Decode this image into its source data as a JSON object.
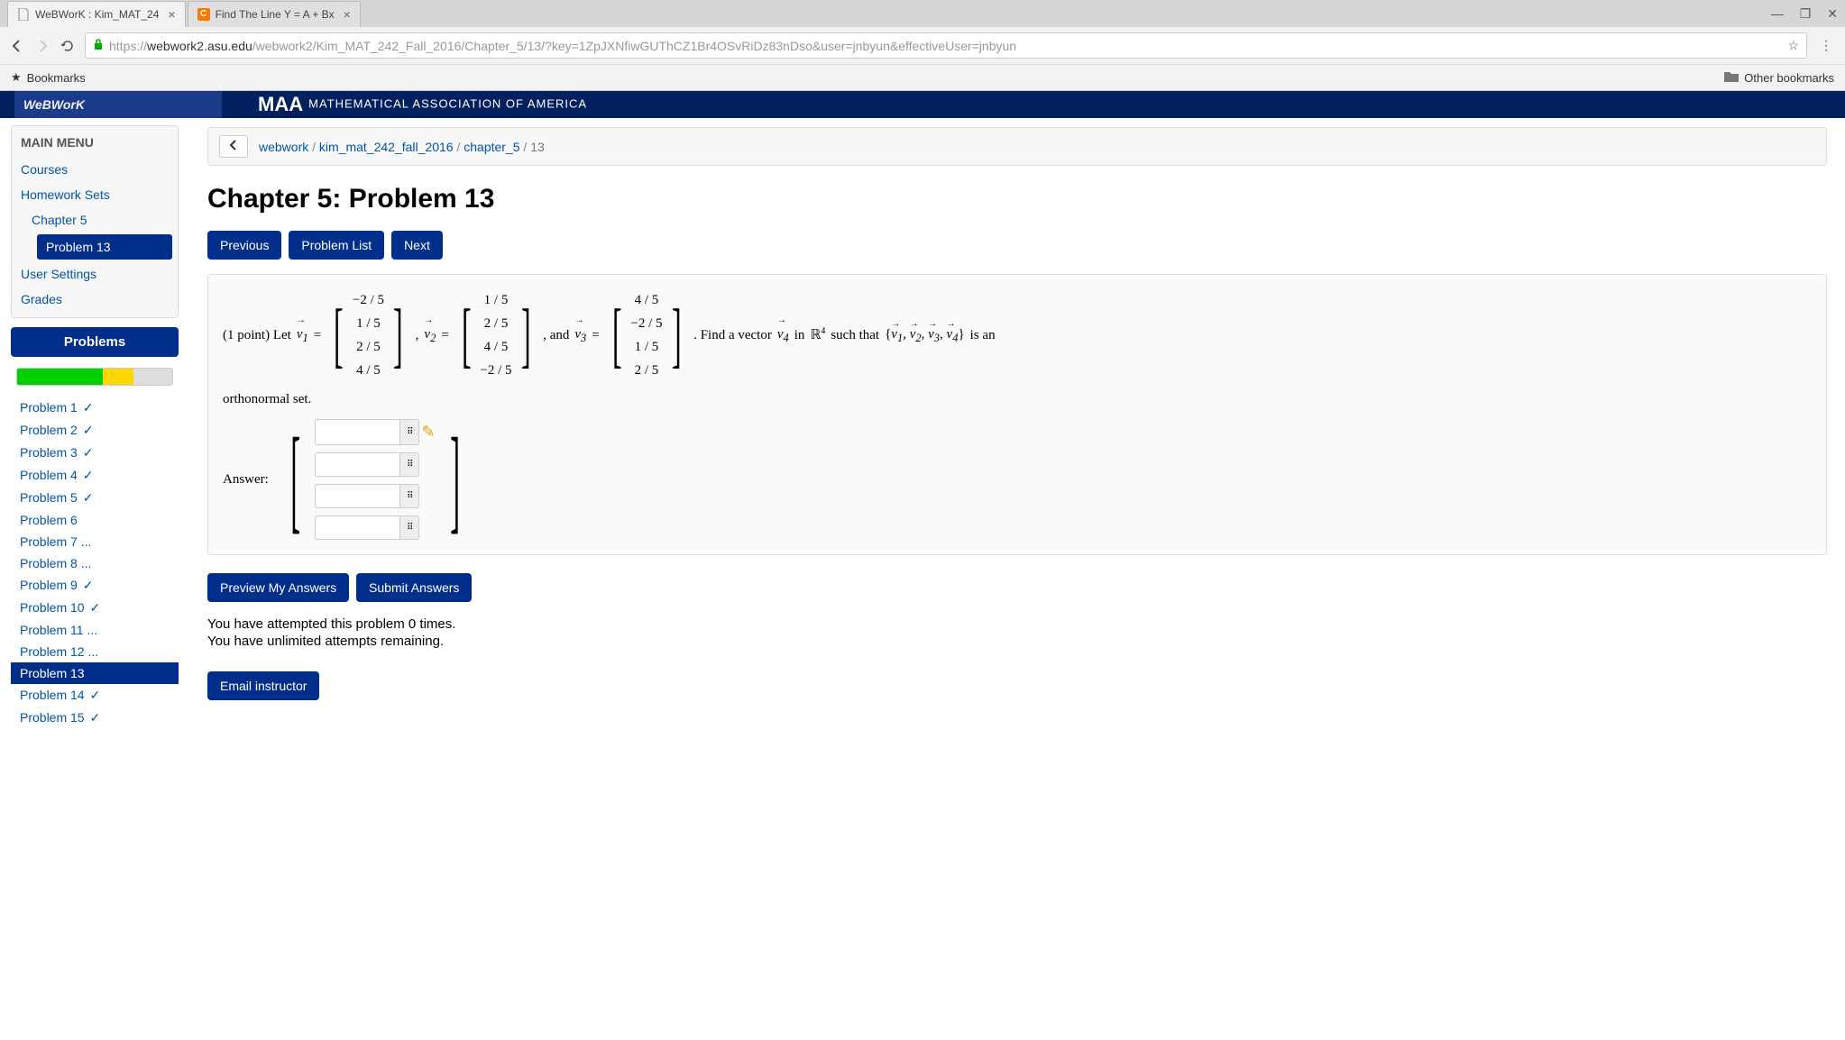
{
  "browser": {
    "tabs": [
      {
        "title": "WeBWorK : Kim_MAT_24",
        "active": true,
        "favicon": "page"
      },
      {
        "title": "Find The Line Y = A + Bx",
        "active": false,
        "favicon": "c"
      }
    ],
    "url_prefix": "https://",
    "url_host": "webwork2.asu.edu",
    "url_path": "/webwork2/Kim_MAT_242_Fall_2016/Chapter_5/13/?key=1ZpJXNfiwGUThCZ1Br4OSvRiDz83nDso&user=jnbyun&effectiveUser=jnbyun",
    "bookmarks_label": "Bookmarks",
    "other_bookmarks": "Other bookmarks"
  },
  "maa": {
    "webwork": "WeBWorK",
    "brand": "MAA",
    "subtitle": "MATHEMATICAL ASSOCIATION OF AMERICA"
  },
  "sidebar": {
    "main_menu": "MAIN MENU",
    "items": [
      "Courses",
      "Homework Sets",
      "Chapter 5",
      "Problem 13",
      "User Settings",
      "Grades"
    ],
    "problems_header": "Problems",
    "progress": {
      "green": 55,
      "yellow": 20,
      "gray": 25
    },
    "problem_list": [
      {
        "label": "Problem 1",
        "status": "check"
      },
      {
        "label": "Problem 2",
        "status": "check"
      },
      {
        "label": "Problem 3",
        "status": "check"
      },
      {
        "label": "Problem 4",
        "status": "check"
      },
      {
        "label": "Problem 5",
        "status": "check"
      },
      {
        "label": "Problem 6",
        "status": "none"
      },
      {
        "label": "Problem 7",
        "status": "dots"
      },
      {
        "label": "Problem 8",
        "status": "dots"
      },
      {
        "label": "Problem 9",
        "status": "check"
      },
      {
        "label": "Problem 10",
        "status": "check"
      },
      {
        "label": "Problem 11",
        "status": "dots"
      },
      {
        "label": "Problem 12",
        "status": "dots"
      },
      {
        "label": "Problem 13",
        "status": "none",
        "active": true
      },
      {
        "label": "Problem 14",
        "status": "check"
      },
      {
        "label": "Problem 15",
        "status": "check"
      }
    ]
  },
  "breadcrumb": {
    "items": [
      "webwork",
      "kim_mat_242_fall_2016",
      "chapter_5",
      "13"
    ]
  },
  "content": {
    "title": "Chapter 5: Problem 13",
    "nav": {
      "prev": "Previous",
      "list": "Problem List",
      "next": "Next"
    },
    "points_prefix": "(1 point) Let ",
    "v1": [
      "−2 / 5",
      "1 / 5",
      "2 / 5",
      "4 / 5"
    ],
    "v2": [
      "1 / 5",
      "2 / 5",
      "4 / 5",
      "−2 / 5"
    ],
    "v3": [
      "4 / 5",
      "−2 / 5",
      "1 / 5",
      "2 / 5"
    ],
    "connector_and": ", and ",
    "find_text": ". Find a vector ",
    "in_text": " in ",
    "r_label": "ℝ",
    "r_sup": "4",
    "such_that": " such that ",
    "set_text": " is an",
    "orthonormal": "orthonormal set.",
    "answer_label": "Answer:",
    "preview": "Preview My Answers",
    "submit": "Submit Answers",
    "attempts1": "You have attempted this problem 0 times.",
    "attempts2": "You have unlimited attempts remaining.",
    "email": "Email instructor"
  }
}
